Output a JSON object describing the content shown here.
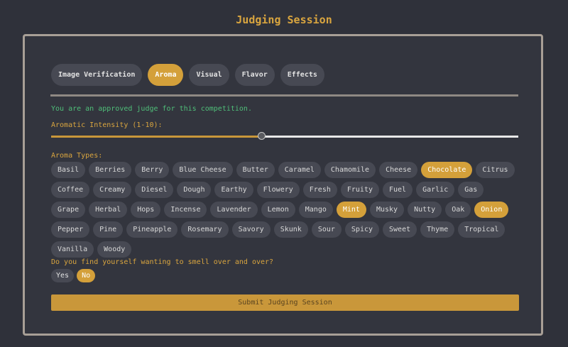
{
  "page": {
    "title": "Judging Session"
  },
  "tabs": [
    {
      "label": "Image Verification",
      "active": false
    },
    {
      "label": "Aroma",
      "active": true
    },
    {
      "label": "Visual",
      "active": false
    },
    {
      "label": "Flavor",
      "active": false
    },
    {
      "label": "Effects",
      "active": false
    }
  ],
  "aroma": {
    "approved_message": "You are an approved judge for this competition.",
    "intensity_label": "Aromatic Intensity (1-10):",
    "intensity_min": 1,
    "intensity_max": 10,
    "intensity_fraction": 0.45,
    "types_label": "Aroma Types:",
    "types": [
      {
        "label": "Basil",
        "selected": false
      },
      {
        "label": "Berries",
        "selected": false
      },
      {
        "label": "Berry",
        "selected": false
      },
      {
        "label": "Blue Cheese",
        "selected": false
      },
      {
        "label": "Butter",
        "selected": false
      },
      {
        "label": "Caramel",
        "selected": false
      },
      {
        "label": "Chamomile",
        "selected": false
      },
      {
        "label": "Cheese",
        "selected": false
      },
      {
        "label": "Chocolate",
        "selected": true
      },
      {
        "label": "Citrus",
        "selected": false
      },
      {
        "label": "Coffee",
        "selected": false
      },
      {
        "label": "Creamy",
        "selected": false
      },
      {
        "label": "Diesel",
        "selected": false
      },
      {
        "label": "Dough",
        "selected": false
      },
      {
        "label": "Earthy",
        "selected": false
      },
      {
        "label": "Flowery",
        "selected": false
      },
      {
        "label": "Fresh",
        "selected": false
      },
      {
        "label": "Fruity",
        "selected": false
      },
      {
        "label": "Fuel",
        "selected": false
      },
      {
        "label": "Garlic",
        "selected": false
      },
      {
        "label": "Gas",
        "selected": false
      },
      {
        "label": "Grape",
        "selected": false
      },
      {
        "label": "Herbal",
        "selected": false
      },
      {
        "label": "Hops",
        "selected": false
      },
      {
        "label": "Incense",
        "selected": false
      },
      {
        "label": "Lavender",
        "selected": false
      },
      {
        "label": "Lemon",
        "selected": false
      },
      {
        "label": "Mango",
        "selected": false
      },
      {
        "label": "Mint",
        "selected": true
      },
      {
        "label": "Musky",
        "selected": false
      },
      {
        "label": "Nutty",
        "selected": false
      },
      {
        "label": "Oak",
        "selected": false
      },
      {
        "label": "Onion",
        "selected": true
      },
      {
        "label": "Pepper",
        "selected": false
      },
      {
        "label": "Pine",
        "selected": false
      },
      {
        "label": "Pineapple",
        "selected": false
      },
      {
        "label": "Rosemary",
        "selected": false
      },
      {
        "label": "Savory",
        "selected": false
      },
      {
        "label": "Skunk",
        "selected": false
      },
      {
        "label": "Sour",
        "selected": false
      },
      {
        "label": "Spicy",
        "selected": false
      },
      {
        "label": "Sweet",
        "selected": false
      },
      {
        "label": "Thyme",
        "selected": false
      },
      {
        "label": "Tropical",
        "selected": false
      },
      {
        "label": "Vanilla",
        "selected": false
      },
      {
        "label": "Woody",
        "selected": false
      }
    ],
    "question": "Do you find yourself wanting to smell over and over?",
    "answers": [
      {
        "label": "Yes",
        "selected": false
      },
      {
        "label": "No",
        "selected": true
      }
    ]
  },
  "submit_label": "Submit Judging Session",
  "colors": {
    "accent": "#d4a03a",
    "approved_text": "#4fbf79",
    "background": "#2f313a"
  }
}
